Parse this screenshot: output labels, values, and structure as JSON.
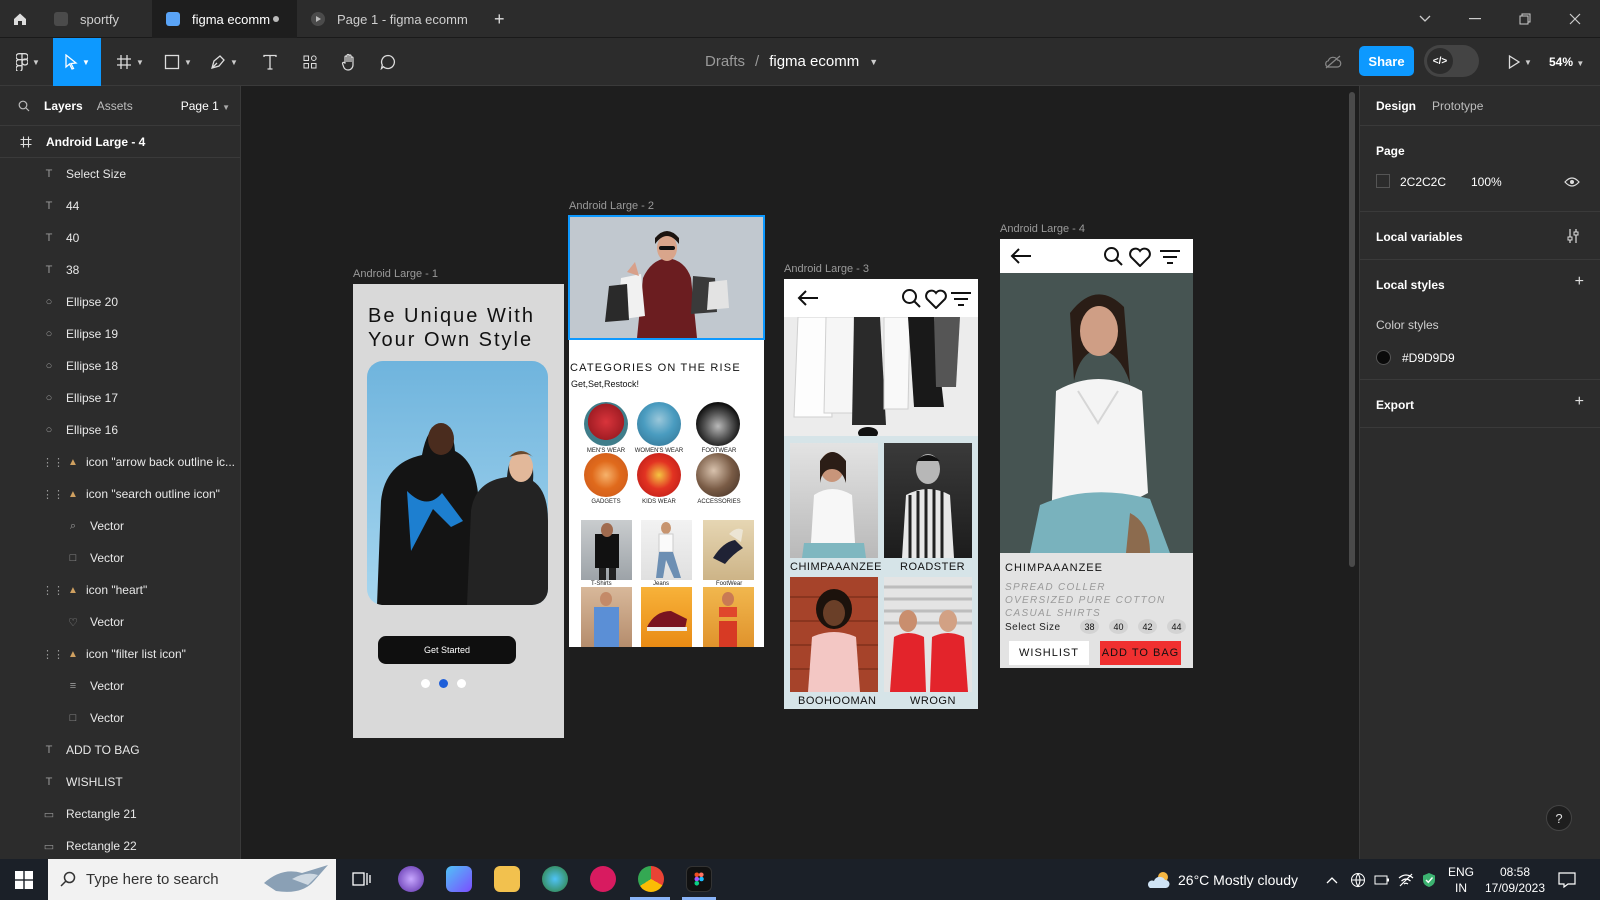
{
  "tabs": [
    {
      "label": "sportfy"
    },
    {
      "label": "figma ecomm"
    },
    {
      "label": "Page 1 - figma ecomm"
    }
  ],
  "toolbar": {
    "breadcrumb_parent": "Drafts",
    "breadcrumb_separator": "/",
    "file_name": "figma ecomm",
    "share_label": "Share",
    "dev_mode_icon": "</>",
    "zoom": "54%"
  },
  "left_panel": {
    "tab_layers": "Layers",
    "tab_assets": "Assets",
    "page_selector": "Page 1",
    "frame_name": "Android Large - 4",
    "layers": [
      {
        "label": "Select Size",
        "icon": "text-icon"
      },
      {
        "label": "44",
        "icon": "text-icon"
      },
      {
        "label": "40",
        "icon": "text-icon"
      },
      {
        "label": "38",
        "icon": "text-icon"
      },
      {
        "label": "Ellipse 20",
        "icon": "ellipse-icon"
      },
      {
        "label": "Ellipse 19",
        "icon": "ellipse-icon"
      },
      {
        "label": "Ellipse 18",
        "icon": "ellipse-icon"
      },
      {
        "label": "Ellipse 17",
        "icon": "ellipse-icon"
      },
      {
        "label": "Ellipse 16",
        "icon": "ellipse-icon"
      },
      {
        "label": "icon \"arrow back outline ic...",
        "icon": "component-icon"
      },
      {
        "label": "icon \"search outline icon\"",
        "icon": "component-icon"
      },
      {
        "label": "Vector",
        "icon": "search-vector-icon"
      },
      {
        "label": "Vector",
        "icon": "square-vector-icon"
      },
      {
        "label": "icon \"heart\"",
        "icon": "component-icon"
      },
      {
        "label": "Vector",
        "icon": "heart-vector-icon"
      },
      {
        "label": "icon \"filter list icon\"",
        "icon": "component-icon"
      },
      {
        "label": "Vector",
        "icon": "filter-vector-icon"
      },
      {
        "label": "Vector",
        "icon": "square-vector-icon"
      },
      {
        "label": "ADD TO BAG",
        "icon": "text-icon"
      },
      {
        "label": "WISHLIST",
        "icon": "text-icon"
      },
      {
        "label": "Rectangle 21",
        "icon": "rectangle-icon"
      },
      {
        "label": "Rectangle 22",
        "icon": "rectangle-icon"
      }
    ]
  },
  "canvas": {
    "frame1": {
      "label": "Android Large - 1",
      "headline_line1": "Be Unique With",
      "headline_line2": "Your Own Style",
      "button": "Get Started"
    },
    "frame2": {
      "label": "Android Large - 2",
      "heading": "CATEGORIES ON THE RISE",
      "subheading": "Get,Set,Restock!",
      "categories": [
        "MEN'S WEAR",
        "WOMEN'S WEAR",
        "FOOTWEAR",
        "GADGETS",
        "KIDS WEAR",
        "ACCESSORIES"
      ],
      "tiles": [
        "T-Shirts",
        "Jeans",
        "FootWear"
      ]
    },
    "frame3": {
      "label": "Android Large - 3",
      "products": [
        "CHIMPAAANZEE",
        "ROADSTER",
        "BOOHOOMAN",
        "WROGN"
      ]
    },
    "frame4": {
      "label": "Android Large - 4",
      "brand": "CHIMPAAANZEE",
      "desc_line1": "SPREAD COLLER",
      "desc_line2": "OVERSIZED PURE COTTON",
      "desc_line3": "CASUAL SHIRTS",
      "size_label": "Select Size",
      "sizes": [
        "38",
        "40",
        "42",
        "44"
      ],
      "wishlist": "WISHLIST",
      "add_to_bag": "ADD TO BAG"
    }
  },
  "right_panel": {
    "tab_design": "Design",
    "tab_prototype": "Prototype",
    "page_title": "Page",
    "page_color": "2C2C2C",
    "page_opacity": "100%",
    "local_variables": "Local variables",
    "local_styles": "Local styles",
    "color_styles": "Color styles",
    "color_style_value": "#D9D9D9",
    "export": "Export",
    "help": "?"
  },
  "taskbar": {
    "search_placeholder": "Type here to search",
    "weather_temp": "26°C",
    "weather_text": "Mostly cloudy",
    "lang_line1": "ENG",
    "lang_line2": "IN",
    "time": "08:58",
    "date": "17/09/2023"
  },
  "colors": {
    "accent": "#0d99ff",
    "bag_red": "#f03030",
    "swatch": "#D9D9D9",
    "page_bg": "#2C2C2C"
  }
}
